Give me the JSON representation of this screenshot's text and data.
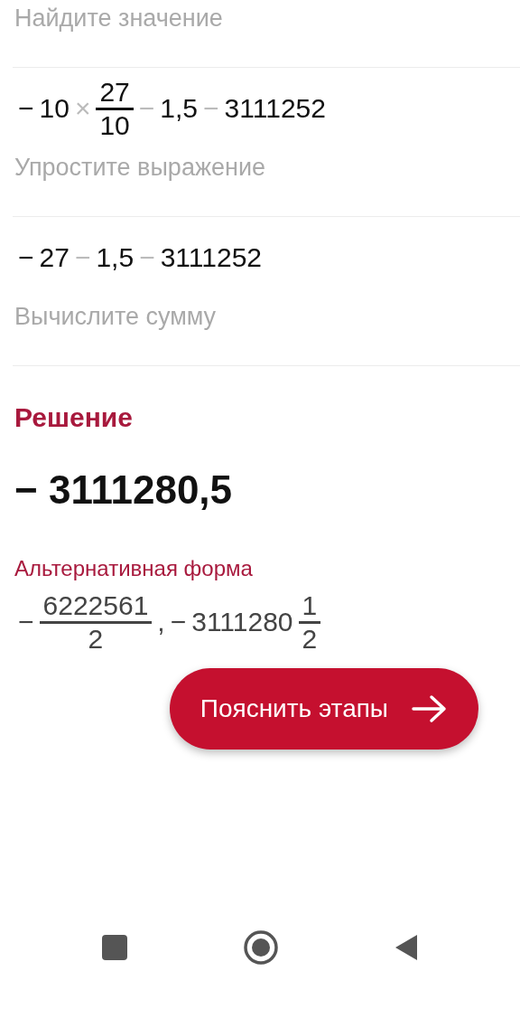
{
  "top_caption": "Найдите значение",
  "steps": [
    {
      "tokens": [
        {
          "kind": "sign",
          "text": "−"
        },
        {
          "kind": "num",
          "text": "10"
        },
        {
          "kind": "op",
          "text": "×"
        },
        {
          "kind": "frac",
          "num": "27",
          "den": "10"
        },
        {
          "kind": "op",
          "text": "−"
        },
        {
          "kind": "num",
          "text": "1,5"
        },
        {
          "kind": "op",
          "text": "−"
        },
        {
          "kind": "num",
          "text": "3111252"
        }
      ],
      "caption": "Упростите выражение"
    },
    {
      "tokens": [
        {
          "kind": "sign",
          "text": "−"
        },
        {
          "kind": "num",
          "text": "27"
        },
        {
          "kind": "op",
          "text": "−"
        },
        {
          "kind": "num",
          "text": "1,5"
        },
        {
          "kind": "op",
          "text": "−"
        },
        {
          "kind": "num",
          "text": "3111252"
        }
      ],
      "caption": "Вычислите сумму"
    }
  ],
  "solution": {
    "title": "Решение",
    "value": "− 3111280,5"
  },
  "alternative": {
    "title": "Альтернативная форма",
    "tokens": [
      {
        "kind": "sign",
        "text": "−"
      },
      {
        "kind": "frac",
        "num": "6222561",
        "den": "2"
      },
      {
        "kind": "num",
        "text": ","
      },
      {
        "kind": "sign",
        "text": "−"
      },
      {
        "kind": "num",
        "text": "3111280"
      },
      {
        "kind": "frac",
        "num": "1",
        "den": "2"
      }
    ]
  },
  "button": {
    "label": "Пояснить этапы"
  }
}
